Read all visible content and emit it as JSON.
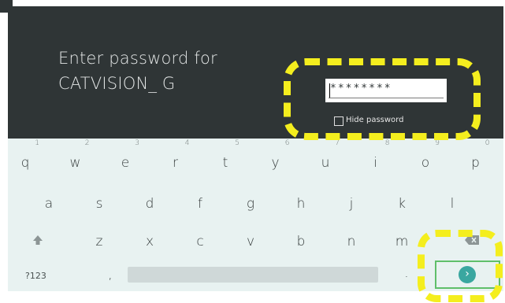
{
  "prompt": {
    "line1": "Enter password for",
    "line2": "CATVISION_ G"
  },
  "password": {
    "value": "********",
    "cursor_visible": true
  },
  "hide_password": {
    "label": "Hide password",
    "checked": false
  },
  "keyboard": {
    "row1": [
      {
        "key": "q",
        "hint": "1"
      },
      {
        "key": "w",
        "hint": "2"
      },
      {
        "key": "e",
        "hint": "3"
      },
      {
        "key": "r",
        "hint": "4"
      },
      {
        "key": "t",
        "hint": "5"
      },
      {
        "key": "y",
        "hint": "6"
      },
      {
        "key": "u",
        "hint": "7"
      },
      {
        "key": "i",
        "hint": "8"
      },
      {
        "key": "o",
        "hint": "9"
      },
      {
        "key": "p",
        "hint": "0"
      }
    ],
    "row2": [
      "a",
      "s",
      "d",
      "f",
      "g",
      "h",
      "j",
      "k",
      "l"
    ],
    "row3": [
      "z",
      "x",
      "c",
      "v",
      "b",
      "n",
      "m"
    ],
    "bottom": {
      "symbols_label": "?123",
      "comma_label": ",",
      "period_label": "."
    },
    "enter_icon": "chevron-right-icon",
    "shift_icon": "shift-arrow-icon",
    "backspace_icon": "backspace-icon"
  },
  "colors": {
    "screen_bg": "#2f3536",
    "keyboard_bg": "#e8f2f1",
    "accent": "#3aa7a0",
    "highlight": "#f4ee1e",
    "enter_outline": "#5fbf6a"
  }
}
